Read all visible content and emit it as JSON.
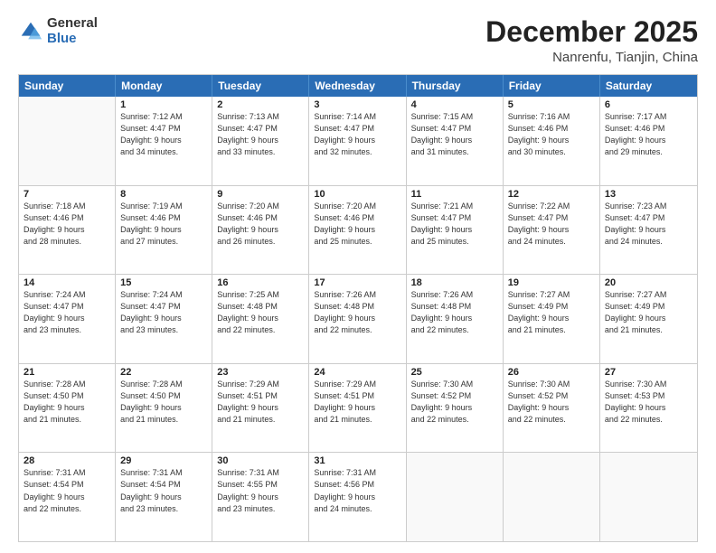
{
  "logo": {
    "general": "General",
    "blue": "Blue"
  },
  "title": {
    "month": "December 2025",
    "location": "Nanrenfu, Tianjin, China"
  },
  "calendar": {
    "days_of_week": [
      "Sunday",
      "Monday",
      "Tuesday",
      "Wednesday",
      "Thursday",
      "Friday",
      "Saturday"
    ],
    "rows": [
      [
        {
          "day": "",
          "lines": []
        },
        {
          "day": "1",
          "lines": [
            "Sunrise: 7:12 AM",
            "Sunset: 4:47 PM",
            "Daylight: 9 hours",
            "and 34 minutes."
          ]
        },
        {
          "day": "2",
          "lines": [
            "Sunrise: 7:13 AM",
            "Sunset: 4:47 PM",
            "Daylight: 9 hours",
            "and 33 minutes."
          ]
        },
        {
          "day": "3",
          "lines": [
            "Sunrise: 7:14 AM",
            "Sunset: 4:47 PM",
            "Daylight: 9 hours",
            "and 32 minutes."
          ]
        },
        {
          "day": "4",
          "lines": [
            "Sunrise: 7:15 AM",
            "Sunset: 4:47 PM",
            "Daylight: 9 hours",
            "and 31 minutes."
          ]
        },
        {
          "day": "5",
          "lines": [
            "Sunrise: 7:16 AM",
            "Sunset: 4:46 PM",
            "Daylight: 9 hours",
            "and 30 minutes."
          ]
        },
        {
          "day": "6",
          "lines": [
            "Sunrise: 7:17 AM",
            "Sunset: 4:46 PM",
            "Daylight: 9 hours",
            "and 29 minutes."
          ]
        }
      ],
      [
        {
          "day": "7",
          "lines": [
            "Sunrise: 7:18 AM",
            "Sunset: 4:46 PM",
            "Daylight: 9 hours",
            "and 28 minutes."
          ]
        },
        {
          "day": "8",
          "lines": [
            "Sunrise: 7:19 AM",
            "Sunset: 4:46 PM",
            "Daylight: 9 hours",
            "and 27 minutes."
          ]
        },
        {
          "day": "9",
          "lines": [
            "Sunrise: 7:20 AM",
            "Sunset: 4:46 PM",
            "Daylight: 9 hours",
            "and 26 minutes."
          ]
        },
        {
          "day": "10",
          "lines": [
            "Sunrise: 7:20 AM",
            "Sunset: 4:46 PM",
            "Daylight: 9 hours",
            "and 25 minutes."
          ]
        },
        {
          "day": "11",
          "lines": [
            "Sunrise: 7:21 AM",
            "Sunset: 4:47 PM",
            "Daylight: 9 hours",
            "and 25 minutes."
          ]
        },
        {
          "day": "12",
          "lines": [
            "Sunrise: 7:22 AM",
            "Sunset: 4:47 PM",
            "Daylight: 9 hours",
            "and 24 minutes."
          ]
        },
        {
          "day": "13",
          "lines": [
            "Sunrise: 7:23 AM",
            "Sunset: 4:47 PM",
            "Daylight: 9 hours",
            "and 24 minutes."
          ]
        }
      ],
      [
        {
          "day": "14",
          "lines": [
            "Sunrise: 7:24 AM",
            "Sunset: 4:47 PM",
            "Daylight: 9 hours",
            "and 23 minutes."
          ]
        },
        {
          "day": "15",
          "lines": [
            "Sunrise: 7:24 AM",
            "Sunset: 4:47 PM",
            "Daylight: 9 hours",
            "and 23 minutes."
          ]
        },
        {
          "day": "16",
          "lines": [
            "Sunrise: 7:25 AM",
            "Sunset: 4:48 PM",
            "Daylight: 9 hours",
            "and 22 minutes."
          ]
        },
        {
          "day": "17",
          "lines": [
            "Sunrise: 7:26 AM",
            "Sunset: 4:48 PM",
            "Daylight: 9 hours",
            "and 22 minutes."
          ]
        },
        {
          "day": "18",
          "lines": [
            "Sunrise: 7:26 AM",
            "Sunset: 4:48 PM",
            "Daylight: 9 hours",
            "and 22 minutes."
          ]
        },
        {
          "day": "19",
          "lines": [
            "Sunrise: 7:27 AM",
            "Sunset: 4:49 PM",
            "Daylight: 9 hours",
            "and 21 minutes."
          ]
        },
        {
          "day": "20",
          "lines": [
            "Sunrise: 7:27 AM",
            "Sunset: 4:49 PM",
            "Daylight: 9 hours",
            "and 21 minutes."
          ]
        }
      ],
      [
        {
          "day": "21",
          "lines": [
            "Sunrise: 7:28 AM",
            "Sunset: 4:50 PM",
            "Daylight: 9 hours",
            "and 21 minutes."
          ]
        },
        {
          "day": "22",
          "lines": [
            "Sunrise: 7:28 AM",
            "Sunset: 4:50 PM",
            "Daylight: 9 hours",
            "and 21 minutes."
          ]
        },
        {
          "day": "23",
          "lines": [
            "Sunrise: 7:29 AM",
            "Sunset: 4:51 PM",
            "Daylight: 9 hours",
            "and 21 minutes."
          ]
        },
        {
          "day": "24",
          "lines": [
            "Sunrise: 7:29 AM",
            "Sunset: 4:51 PM",
            "Daylight: 9 hours",
            "and 21 minutes."
          ]
        },
        {
          "day": "25",
          "lines": [
            "Sunrise: 7:30 AM",
            "Sunset: 4:52 PM",
            "Daylight: 9 hours",
            "and 22 minutes."
          ]
        },
        {
          "day": "26",
          "lines": [
            "Sunrise: 7:30 AM",
            "Sunset: 4:52 PM",
            "Daylight: 9 hours",
            "and 22 minutes."
          ]
        },
        {
          "day": "27",
          "lines": [
            "Sunrise: 7:30 AM",
            "Sunset: 4:53 PM",
            "Daylight: 9 hours",
            "and 22 minutes."
          ]
        }
      ],
      [
        {
          "day": "28",
          "lines": [
            "Sunrise: 7:31 AM",
            "Sunset: 4:54 PM",
            "Daylight: 9 hours",
            "and 22 minutes."
          ]
        },
        {
          "day": "29",
          "lines": [
            "Sunrise: 7:31 AM",
            "Sunset: 4:54 PM",
            "Daylight: 9 hours",
            "and 23 minutes."
          ]
        },
        {
          "day": "30",
          "lines": [
            "Sunrise: 7:31 AM",
            "Sunset: 4:55 PM",
            "Daylight: 9 hours",
            "and 23 minutes."
          ]
        },
        {
          "day": "31",
          "lines": [
            "Sunrise: 7:31 AM",
            "Sunset: 4:56 PM",
            "Daylight: 9 hours",
            "and 24 minutes."
          ]
        },
        {
          "day": "",
          "lines": []
        },
        {
          "day": "",
          "lines": []
        },
        {
          "day": "",
          "lines": []
        }
      ]
    ]
  }
}
